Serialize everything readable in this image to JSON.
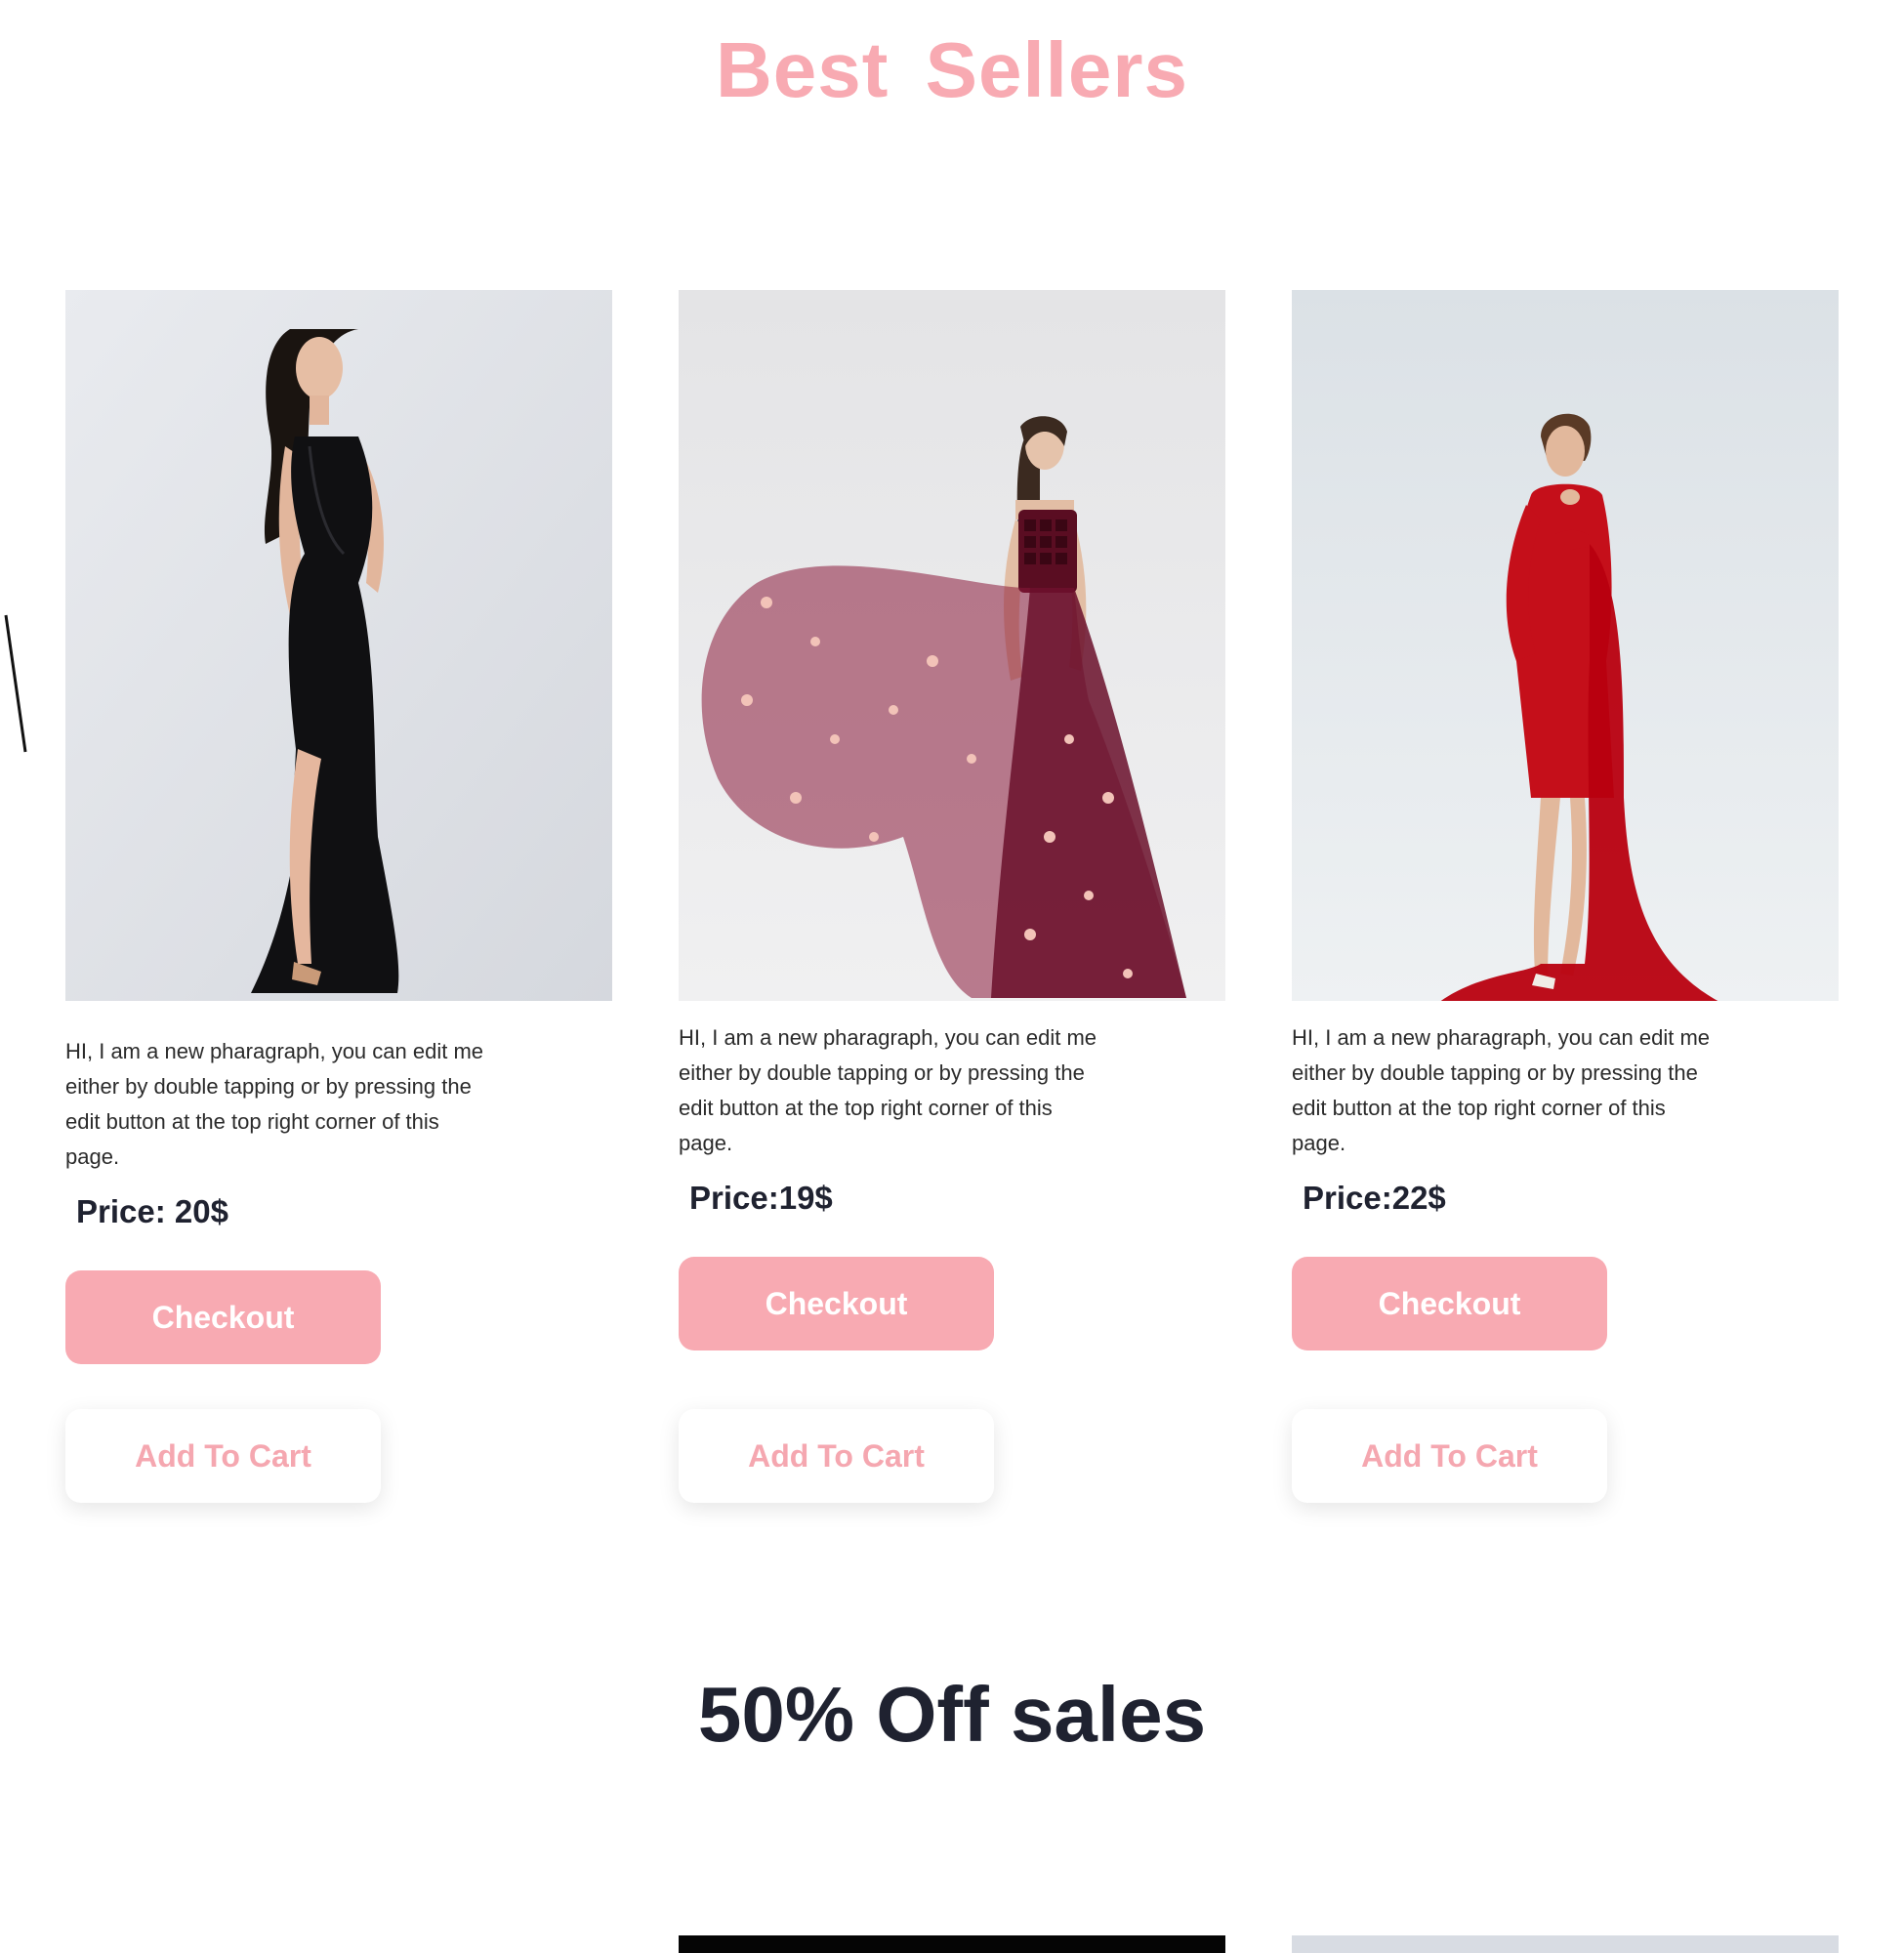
{
  "colors": {
    "accent": "#f8aab2",
    "heading_accent": "#f5a7b0",
    "dark_text": "#1f2230"
  },
  "header": {
    "title": "Best Sellers"
  },
  "products": [
    {
      "description": "HI, I am a new pharagraph, you can edit me either by double tapping or by pressing the edit button at the top right corner of this page.",
      "price": "Price: 20$",
      "checkout_label": "Checkout",
      "cart_label": "Add To Cart"
    },
    {
      "description": "HI, I am a new pharagraph, you can edit me either by double tapping or by pressing the edit button at the top right corner of this page.",
      "price": "Price:19$",
      "checkout_label": "Checkout",
      "cart_label": "Add To Cart"
    },
    {
      "description": "HI, I am a new pharagraph, you can edit me either by double tapping or by pressing the edit button at the top right corner of this page.",
      "price": "Price:22$",
      "checkout_label": "Checkout",
      "cart_label": "Add To Cart"
    }
  ],
  "sale": {
    "title": "50% Off sales"
  }
}
